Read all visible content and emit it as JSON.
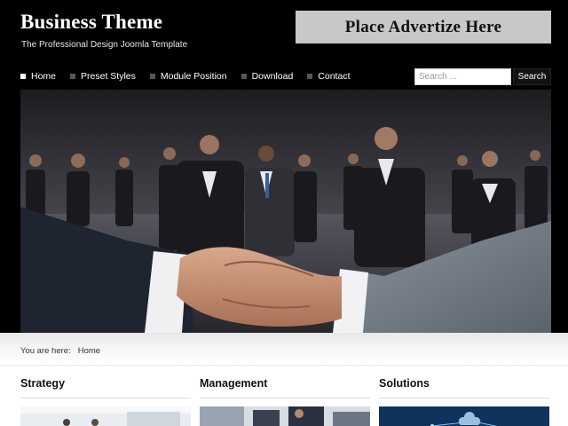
{
  "site": {
    "title": "Business Theme",
    "tagline": "The Professional Design Joomla Template"
  },
  "ad": {
    "text": "Place Advertize Here"
  },
  "nav": {
    "items": [
      {
        "label": "Home",
        "active": true
      },
      {
        "label": "Preset Styles",
        "active": false
      },
      {
        "label": "Module Position",
        "active": false
      },
      {
        "label": "Download",
        "active": false
      },
      {
        "label": "Contact",
        "active": false
      }
    ]
  },
  "search": {
    "placeholder": "Search ...",
    "button_label": "Search"
  },
  "breadcrumb": {
    "prefix": "You are here:",
    "current": "Home"
  },
  "columns": [
    {
      "title": "Strategy"
    },
    {
      "title": "Management"
    },
    {
      "title": "Solutions"
    }
  ],
  "colors": {
    "header_bg": "#000000",
    "ad_bg": "#c8c8c8",
    "active_bullet": "#ffffff",
    "inactive_bullet": "#555555"
  }
}
